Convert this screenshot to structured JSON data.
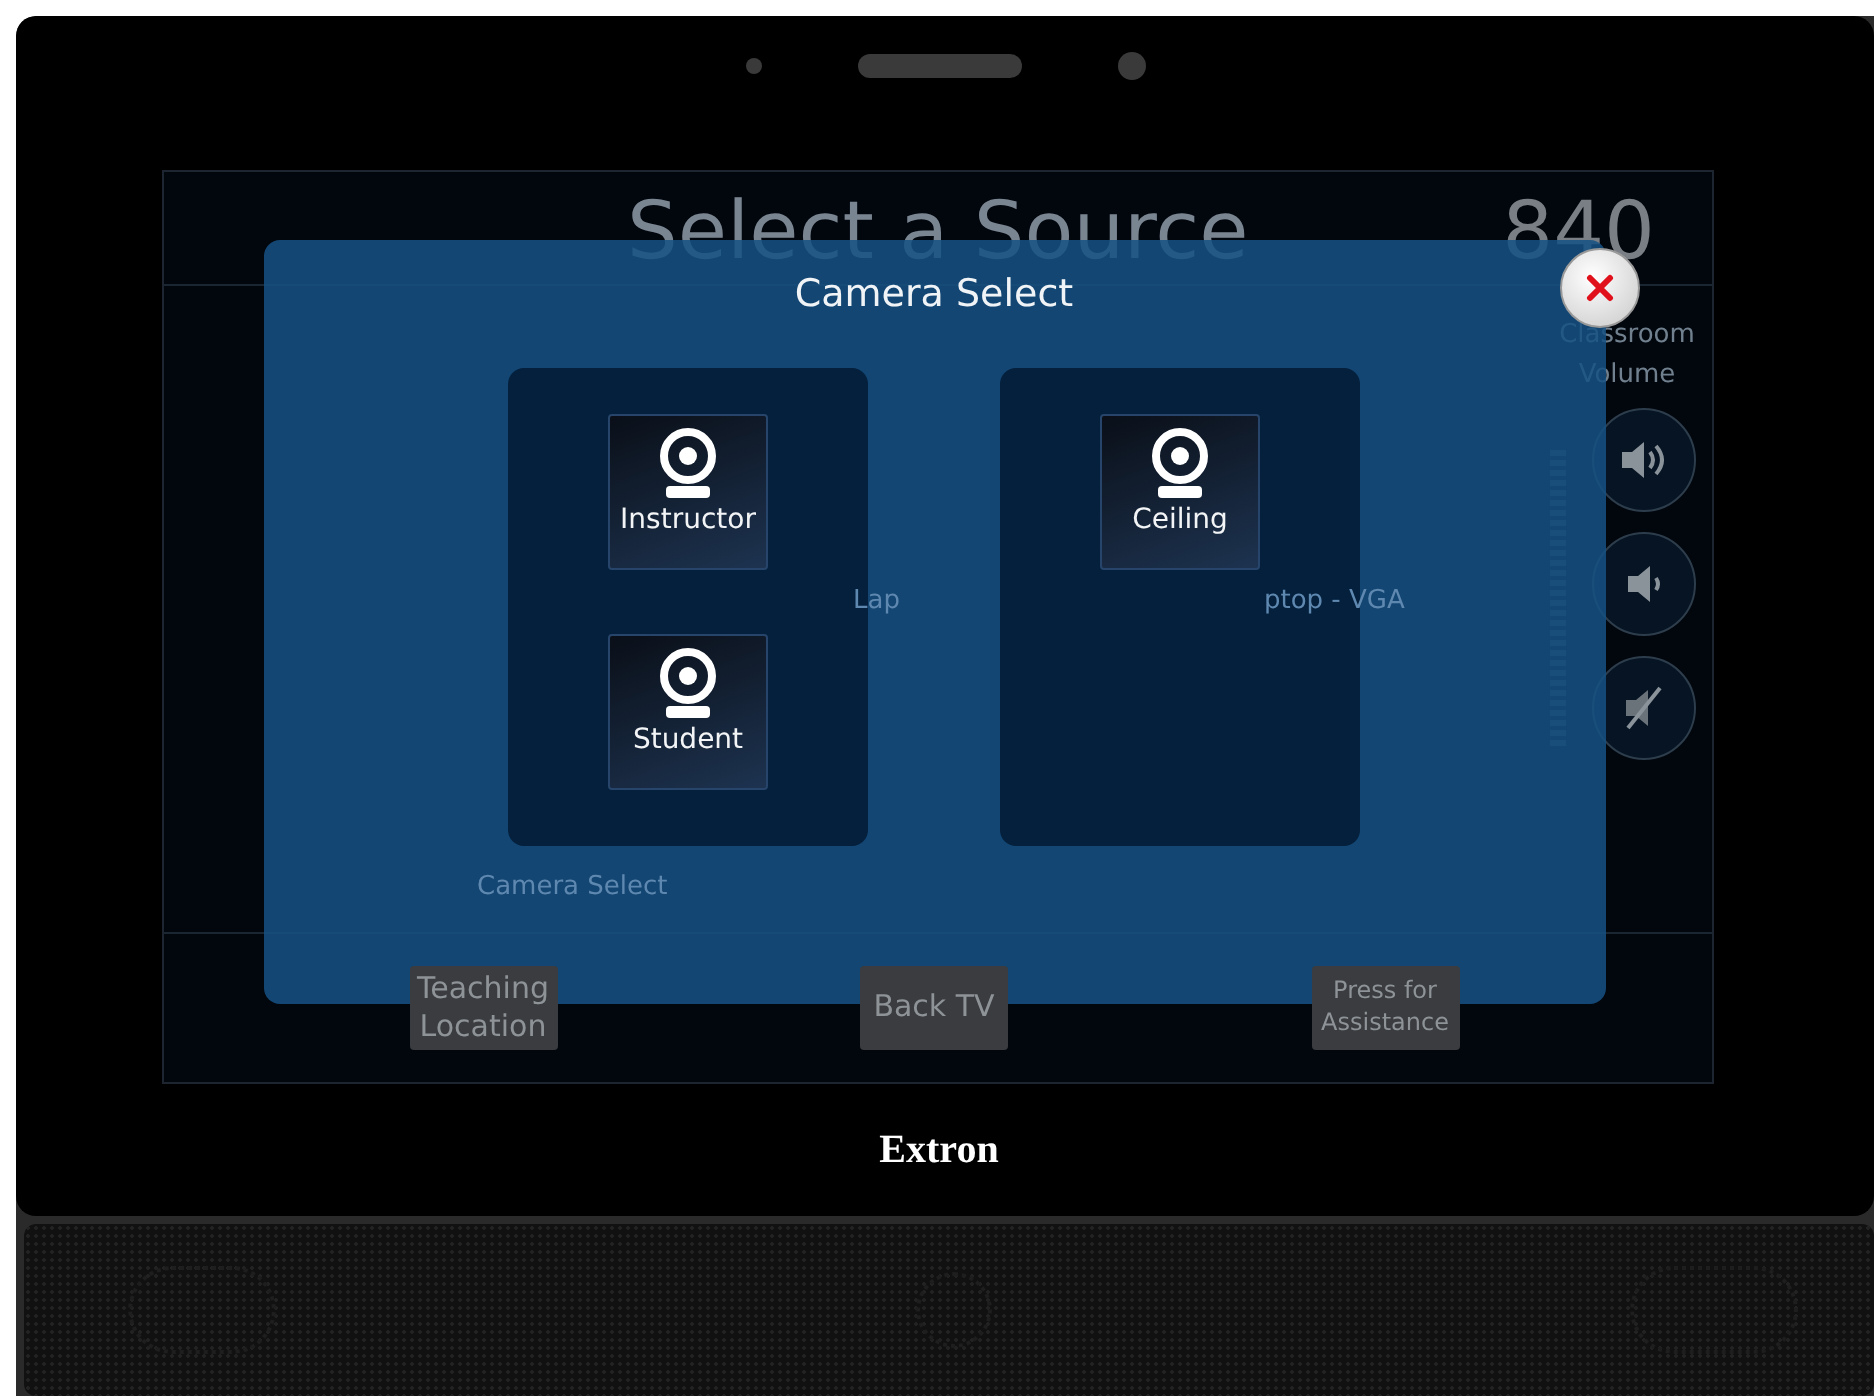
{
  "device": {
    "brand": "Extron"
  },
  "screen": {
    "title": "Select a Source",
    "room": "840",
    "volume": {
      "label": "Classroom Volume",
      "buttons": [
        {
          "kind": "up"
        },
        {
          "kind": "down"
        },
        {
          "kind": "mute"
        }
      ]
    },
    "source_fragments": [
      "Lap",
      "ptop - VGA"
    ],
    "section_label": "Camera Select",
    "footer_buttons": [
      "Teaching Location",
      "Back TV",
      "Press for Assistance"
    ]
  },
  "dialog": {
    "title": "Camera Select",
    "groups": [
      {
        "cameras": [
          "Instructor",
          "Student"
        ]
      },
      {
        "cameras": [
          "Ceiling"
        ]
      }
    ]
  }
}
